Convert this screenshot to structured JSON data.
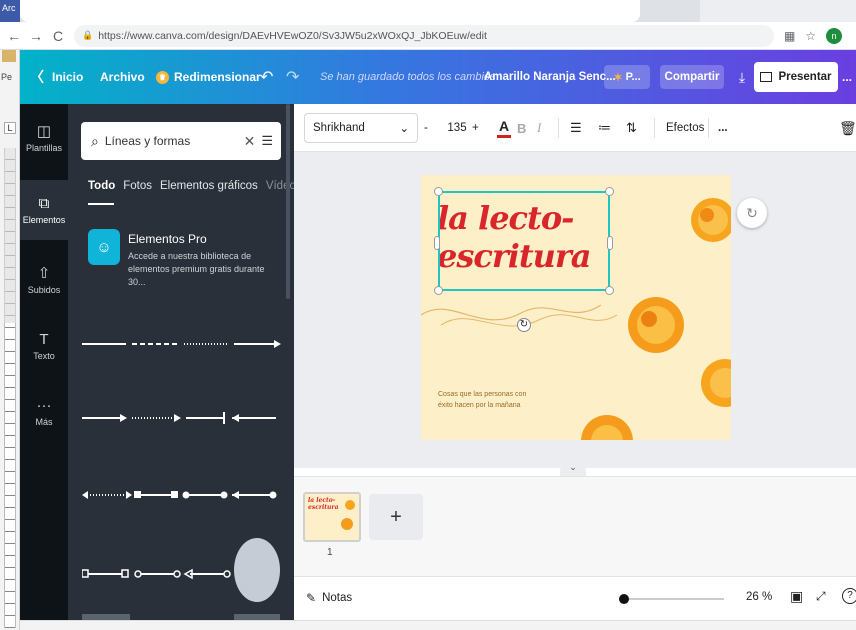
{
  "browser": {
    "url": "https://www.canva.com/design/DAEvHVEwOZ0/Sv3JW5u2xWOxQJ_JbKOEuw/edit",
    "tab_ghost_label": "Arc",
    "profile_letter": "n"
  },
  "word": {
    "left_label": "Pe",
    "ruler_mark": "L"
  },
  "topbar": {
    "home": "Inicio",
    "file": "Archivo",
    "resize": "Redimensionar",
    "saved_status": "Se han guardado todos los cambios",
    "design_title": "Amarillo Naranja Senc...",
    "pro_label": "P...",
    "share": "Compartir",
    "present": "Presentar",
    "more": "..."
  },
  "rail": {
    "items": [
      {
        "label": "Plantillas",
        "icon": "template-icon"
      },
      {
        "label": "Elementos",
        "icon": "elements-icon"
      },
      {
        "label": "Subidos",
        "icon": "upload-icon"
      },
      {
        "label": "Texto",
        "icon": "text-icon"
      },
      {
        "label": "Más",
        "icon": "more-icon"
      }
    ]
  },
  "panel": {
    "search_value": "Líneas y formas",
    "tabs": [
      "Todo",
      "Fotos",
      "Elementos gráficos",
      "Vídeo"
    ],
    "pro_card": {
      "title": "Elementos Pro",
      "description": "Accede a nuestra biblioteca de elementos premium gratis durante 30..."
    }
  },
  "toolbar": {
    "font": "Shrikhand",
    "minus": "-",
    "size": "135",
    "plus": "+",
    "color_letter": "A",
    "bold": "B",
    "italic": "I",
    "effects": "Efectos",
    "more": "..."
  },
  "canvas": {
    "heading_line1": "la lecto-",
    "heading_line2": "escritura",
    "subtitle_line1": "Cosas que las personas con",
    "subtitle_line2": "éxito hacen por la mañana"
  },
  "pages": {
    "thumb_text_line1": "la lecto-",
    "thumb_text_line2": "escritura",
    "page_number": "1",
    "add_label": "+"
  },
  "footer": {
    "notes": "Notas",
    "zoom": "26 %",
    "zoom_fraction": 0.26,
    "help": "?"
  },
  "colors": {
    "heading": "#d8262b",
    "page_bg": "#fdf0c8",
    "selection": "#20c5c5",
    "topbar_start": "#02b3c8",
    "topbar_end": "#6a3fe0"
  }
}
